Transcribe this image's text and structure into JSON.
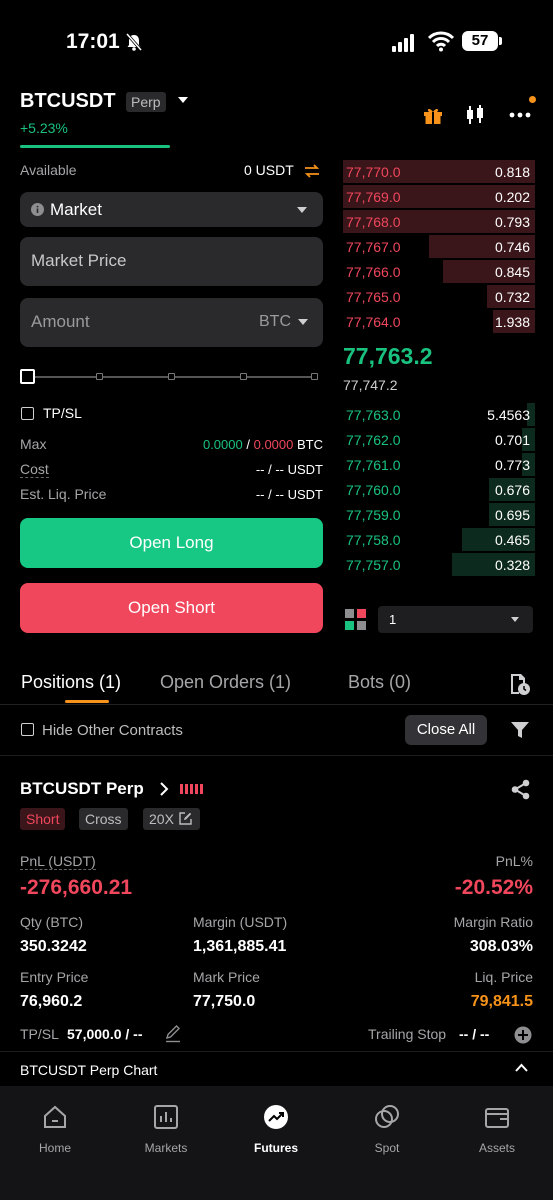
{
  "status": {
    "time": "17:01",
    "battery": "57"
  },
  "header": {
    "pair": "BTCUSDT",
    "perp_tag": "Perp",
    "change": "+5.23%"
  },
  "form": {
    "available_label": "Available",
    "available_value": "0 USDT",
    "order_type": "Market",
    "price_placeholder": "Market Price",
    "amount_placeholder": "Amount",
    "amount_unit": "BTC",
    "tpsl_label": "TP/SL",
    "max_label": "Max",
    "max_long": "0.0000",
    "max_sep": "/",
    "max_short": "0.0000",
    "max_unit": "BTC",
    "cost_label": "Cost",
    "cost_value": "-- / -- USDT",
    "liq_label": "Est. Liq. Price",
    "liq_value": "-- / -- USDT",
    "open_long": "Open Long",
    "open_short": "Open Short"
  },
  "orderbook": {
    "asks": [
      {
        "price": "77,770.0",
        "amount": "0.818",
        "depth": 1.0
      },
      {
        "price": "77,769.0",
        "amount": "0.202",
        "depth": 1.0
      },
      {
        "price": "77,768.0",
        "amount": "0.793",
        "depth": 1.0
      },
      {
        "price": "77,767.0",
        "amount": "0.746",
        "depth": 0.55
      },
      {
        "price": "77,766.0",
        "amount": "0.845",
        "depth": 0.48
      },
      {
        "price": "77,765.0",
        "amount": "0.732",
        "depth": 0.25
      },
      {
        "price": "77,764.0",
        "amount": "1.938",
        "depth": 0.22
      }
    ],
    "mid_price": "77,763.2",
    "mark_price": "77,747.2",
    "bids": [
      {
        "price": "77,763.0",
        "amount": "5.4563",
        "depth": 0.04
      },
      {
        "price": "77,762.0",
        "amount": "0.701",
        "depth": 0.07
      },
      {
        "price": "77,761.0",
        "amount": "0.773",
        "depth": 0.07
      },
      {
        "price": "77,760.0",
        "amount": "0.676",
        "depth": 0.24
      },
      {
        "price": "77,759.0",
        "amount": "0.695",
        "depth": 0.24
      },
      {
        "price": "77,758.0",
        "amount": "0.465",
        "depth": 0.38
      },
      {
        "price": "77,757.0",
        "amount": "0.328",
        "depth": 0.43
      }
    ],
    "depth_value": "1"
  },
  "tabs": [
    {
      "label": "Positions (1)"
    },
    {
      "label": "Open Orders (1)"
    },
    {
      "label": "Bots (0)"
    }
  ],
  "filters": {
    "hide_other": "Hide Other Contracts",
    "close_all": "Close All"
  },
  "position": {
    "title": "BTCUSDT Perp",
    "side": "Short",
    "margin_mode": "Cross",
    "leverage": "20X",
    "pnl_label": "PnL (USDT)",
    "pnl_value": "-276,660.21",
    "pnl_pct_label": "PnL%",
    "pnl_pct_value": "-20.52%",
    "qty_label": "Qty (BTC)",
    "qty_value": "350.3242",
    "margin_label": "Margin (USDT)",
    "margin_value": "1,361,885.41",
    "ratio_label": "Margin Ratio",
    "ratio_value": "308.03%",
    "entry_label": "Entry Price",
    "entry_value": "76,960.2",
    "mark_label": "Mark Price",
    "mark_value": "77,750.0",
    "liq_label": "Liq. Price",
    "liq_value": "79,841.5",
    "tpsl_label": "TP/SL",
    "tpsl_value": "57,000.0 / --",
    "trailing_label": "Trailing Stop",
    "trailing_value": "-- / --"
  },
  "chart_bar": {
    "label": "BTCUSDT Perp Chart"
  },
  "nav": [
    {
      "label": "Home"
    },
    {
      "label": "Markets"
    },
    {
      "label": "Futures"
    },
    {
      "label": "Spot"
    },
    {
      "label": "Assets"
    }
  ],
  "colors": {
    "green": "#19c27f",
    "red": "#f0475c",
    "orange": "#f7931a"
  }
}
